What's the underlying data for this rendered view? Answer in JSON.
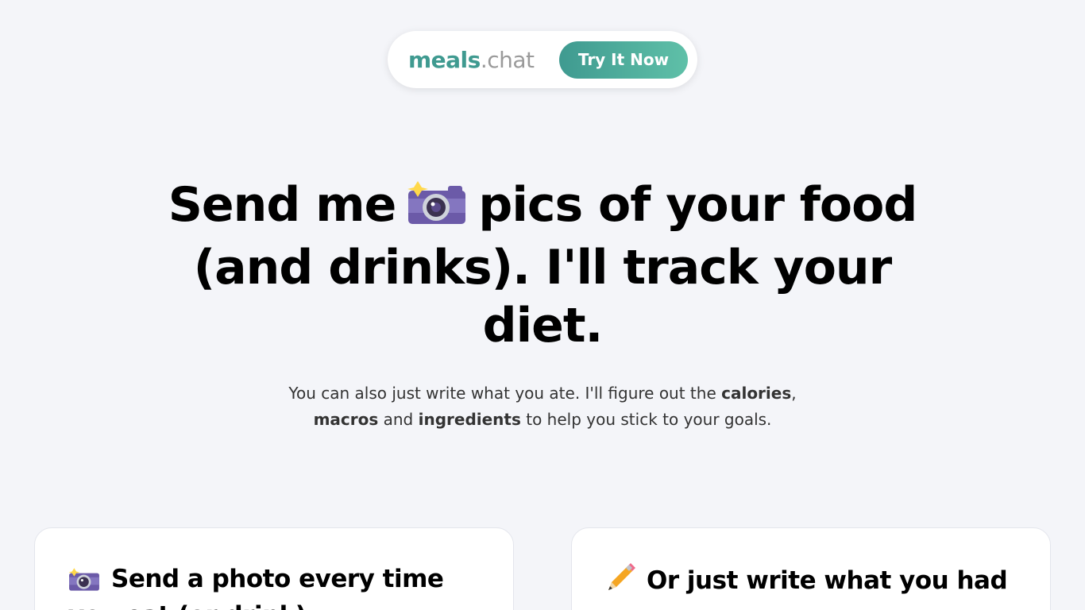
{
  "nav": {
    "brand_main": "meals",
    "brand_tld": ".chat",
    "cta_label": "Try It Now",
    "accent_color": "#3f9a90"
  },
  "hero": {
    "title_part1": "Send me",
    "title_icon": "camera-flash-icon",
    "title_part2": "pics of your food (and drinks). I'll track your diet.",
    "sub_text1": "You can also just write what you ate. I'll figure out the ",
    "sub_bold1": "calories",
    "sub_text2": ",",
    "sub_bold2": "macros",
    "sub_text3": " and ",
    "sub_bold3": "ingredients",
    "sub_text4": " to help you stick to your goals."
  },
  "cards": [
    {
      "icon": "camera-flash-icon",
      "title": "Send a photo every time you eat (or drink)"
    },
    {
      "icon": "pencil-icon",
      "title": "Or just write what you had"
    }
  ]
}
